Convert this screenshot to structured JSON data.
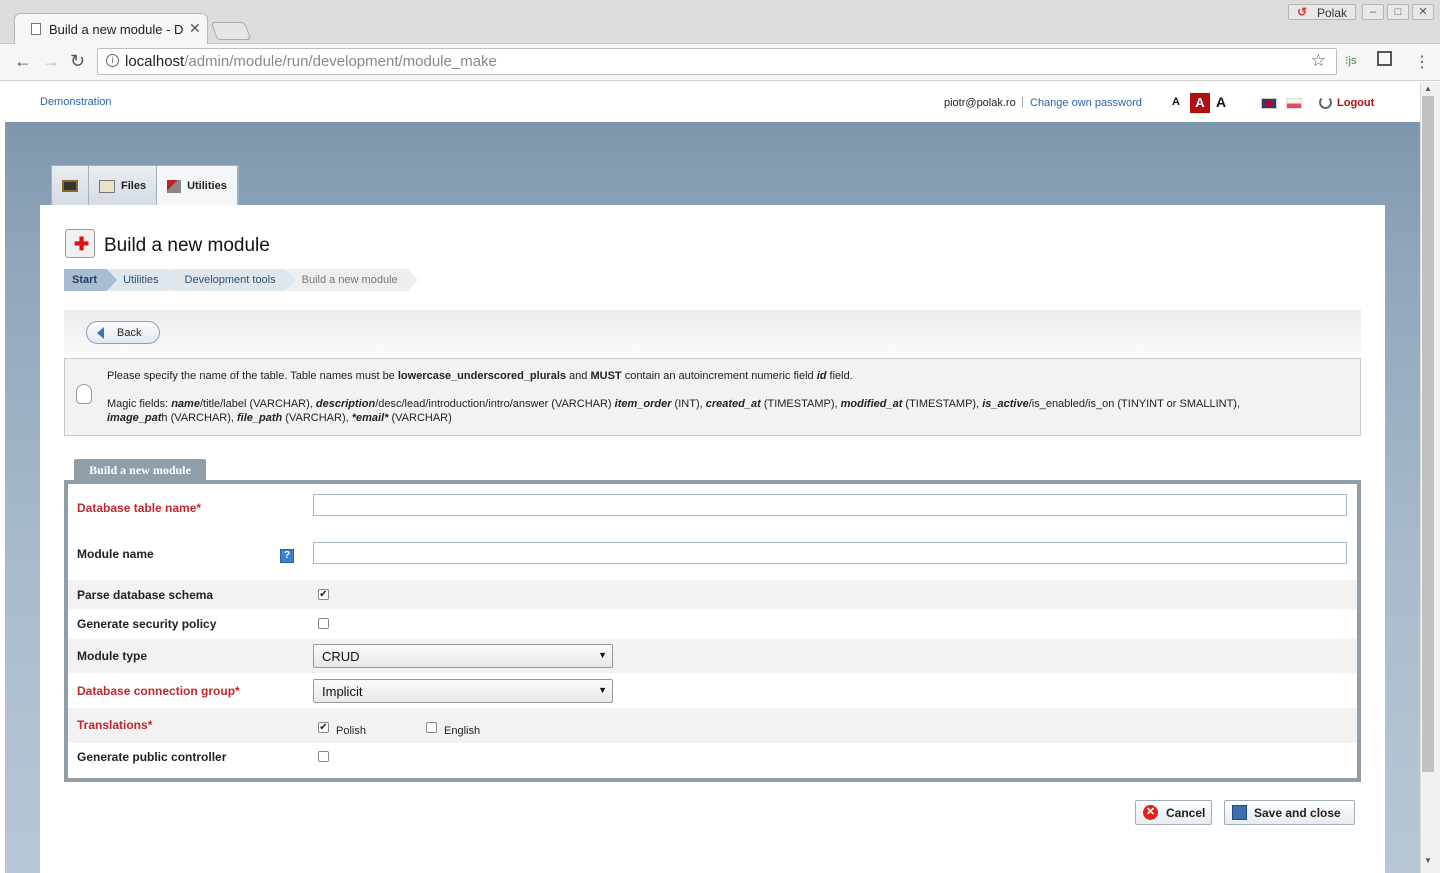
{
  "browser": {
    "tab_title": "Build a new module - De",
    "profile_name": "Polak",
    "url_host": "localhost",
    "url_path": "/admin/module/run/development/module_make"
  },
  "header": {
    "demo_link": "Demonstration",
    "user_email": "piotr@polak.ro",
    "separator": "|",
    "change_password": "Change own password",
    "font_small": "A",
    "font_medium": "A",
    "font_large": "A",
    "logout": "Logout"
  },
  "main_tabs": [
    {
      "label": ""
    },
    {
      "label": "Files"
    },
    {
      "label": "Utilities"
    }
  ],
  "page": {
    "title": "Build a new module"
  },
  "breadcrumb": [
    "Start",
    "Utilities",
    "Development tools",
    "Build a new module"
  ],
  "back_label": "Back",
  "info": {
    "l1_a": "Please specify the name of the table. Table names must be ",
    "l1_b": "lowercase_underscored_plurals",
    "l1_c": " and ",
    "l1_d": "MUST",
    "l1_e": " contain an autoincrement numeric field ",
    "l1_f": "id",
    "l1_g": " field.",
    "l2_prefix": "Magic fields: ",
    "f_name": "name",
    "f_name_rest": "/title/label (VARCHAR), ",
    "f_desc": "description",
    "f_desc_rest": "/desc/lead/introduction/intro/answer (VARCHAR) ",
    "f_order": "item_order",
    "f_order_rest": " (INT), ",
    "f_created": "created_at",
    "f_created_rest": " (TIMESTAMP), ",
    "f_modified": "modified_at",
    "f_modified_rest": " (TIMESTAMP), ",
    "f_active": "is_active",
    "f_active_rest": "/is_enabled/is_on (TINYINT or SMALLINT),",
    "f_image": "image_pat",
    "f_image_rest": "h (VARCHAR), ",
    "f_file": "file_path",
    "f_file_rest": " (VARCHAR), ",
    "f_email": "*email*",
    "f_email_rest": " (VARCHAR)"
  },
  "form": {
    "tab_label": "Build a new module",
    "fields": {
      "table_name": {
        "label": "Database table name*",
        "value": ""
      },
      "module_name": {
        "label": "Module name",
        "value": "",
        "help": "?"
      },
      "parse_schema": {
        "label": "Parse database schema",
        "checked": true
      },
      "security_policy": {
        "label": "Generate security policy",
        "checked": false
      },
      "module_type": {
        "label": "Module type",
        "value": "CRUD"
      },
      "connection_group": {
        "label": "Database connection group*",
        "value": "Implicit"
      },
      "translations": {
        "label": "Translations*",
        "options": [
          {
            "label": "Polish",
            "checked": true
          },
          {
            "label": "English",
            "checked": false
          }
        ]
      },
      "public_controller": {
        "label": "Generate public controller",
        "checked": false
      }
    },
    "cancel_label": "Cancel",
    "save_label": "Save and close"
  },
  "colors": {
    "required_label": "#c1272d",
    "logout": "#b01010",
    "link": "#2a66a8"
  }
}
